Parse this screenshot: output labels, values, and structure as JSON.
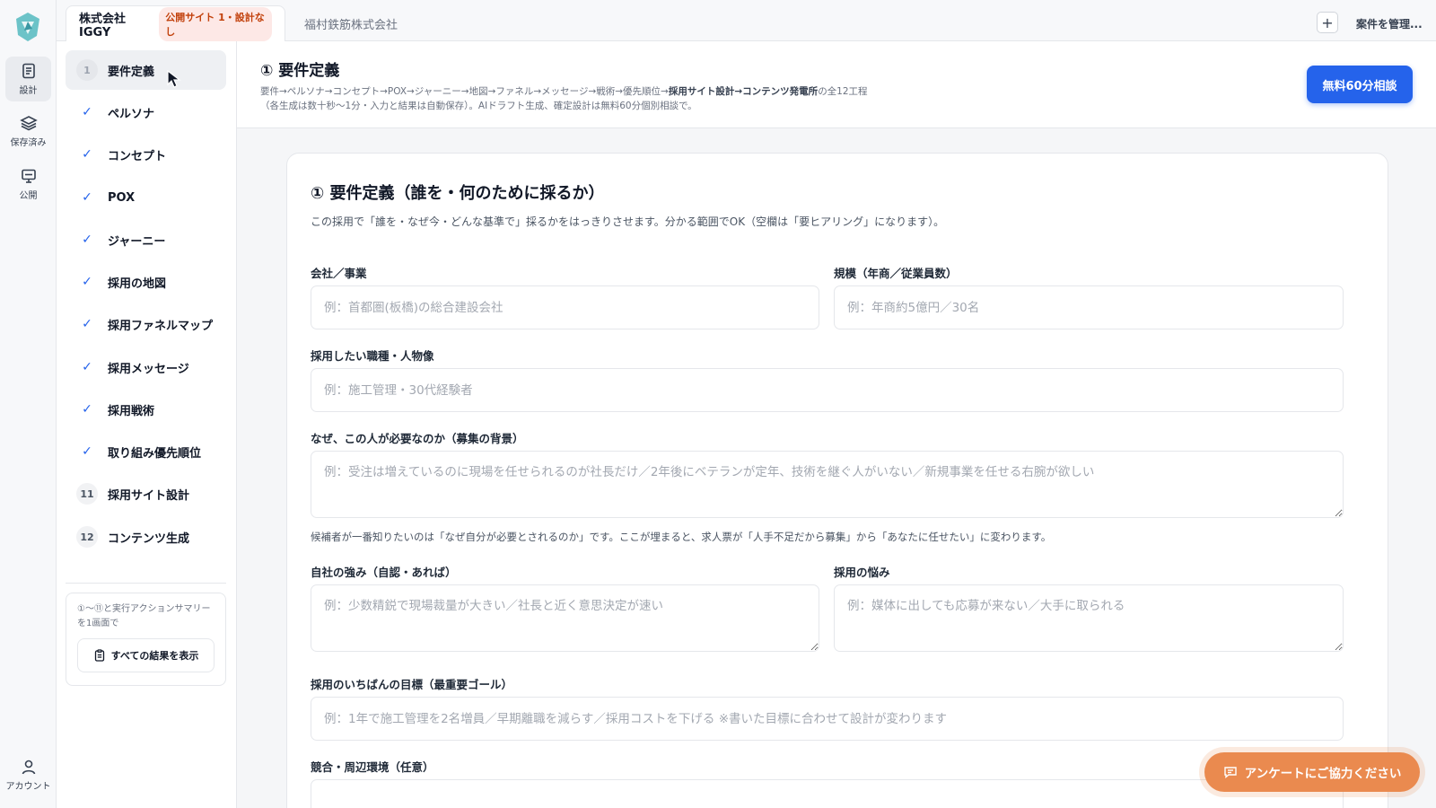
{
  "rail": {
    "items": [
      {
        "label": "設計",
        "icon": "document-icon"
      },
      {
        "label": "保存済み",
        "icon": "layers-icon"
      },
      {
        "label": "公開",
        "icon": "monitor-icon"
      }
    ],
    "account_label": "アカウント"
  },
  "tabs": {
    "active": {
      "label": "株式会社IGGY",
      "badge": "公開サイト 1・設計なし"
    },
    "other": {
      "label": "福村鉄筋株式会社"
    },
    "manage_label": "案件を管理..."
  },
  "steps": {
    "items": [
      {
        "mark": "1",
        "label": "要件定義",
        "state": "current"
      },
      {
        "mark": "✓",
        "label": "ペルソナ",
        "state": "done"
      },
      {
        "mark": "✓",
        "label": "コンセプト",
        "state": "done"
      },
      {
        "mark": "✓",
        "label": "POX",
        "state": "done"
      },
      {
        "mark": "✓",
        "label": "ジャーニー",
        "state": "done"
      },
      {
        "mark": "✓",
        "label": "採用の地図",
        "state": "done"
      },
      {
        "mark": "✓",
        "label": "採用ファネルマップ",
        "state": "done"
      },
      {
        "mark": "✓",
        "label": "採用メッセージ",
        "state": "done"
      },
      {
        "mark": "✓",
        "label": "採用戦術",
        "state": "done"
      },
      {
        "mark": "✓",
        "label": "取り組み優先順位",
        "state": "done"
      },
      {
        "mark": "11",
        "label": "採用サイト設計",
        "state": "todo"
      },
      {
        "mark": "12",
        "label": "コンテンツ生成",
        "state": "todo"
      }
    ],
    "summary_note": "①〜⑪と実行アクションサマリーを1画面で",
    "summary_button": "すべての結果を表示"
  },
  "header": {
    "title": "① 要件定義",
    "flow_plain": "要件→ペルソナ→コンセプト→POX→ジャーニー→地図→ファネル→メッセージ→戦術→優先順位→",
    "flow_bold": "採用サイト設計→コンテンツ発電所",
    "flow_suffix": "の全12工程",
    "flow_line2": "（各生成は数十秒〜1分・入力と結果は自動保存）。AIドラフト生成、確定設計は無料60分個別相談で。",
    "cta_label": "無料60分相談"
  },
  "form": {
    "title": "① 要件定義（誰を・何のために採るか）",
    "description": "この採用で「誰を・なぜ今・どんな基準で」採るかをはっきりさせます。分かる範囲でOK（空欄は「要ヒアリング」になります）。",
    "fields": {
      "company": {
        "label": "会社／事業",
        "placeholder": "例：首都圏(板橋)の総合建設会社",
        "value": ""
      },
      "scale": {
        "label": "規模（年商／従業員数）",
        "placeholder": "例：年商約5億円／30名",
        "value": ""
      },
      "role": {
        "label": "採用したい職種・人物像",
        "placeholder": "例：施工管理・30代経験者",
        "value": ""
      },
      "background": {
        "label": "なぜ、この人が必要なのか（募集の背景）",
        "placeholder": "例：受注は増えているのに現場を任せられるのが社長だけ／2年後にベテランが定年、技術を継ぐ人がいない／新規事業を任せる右腕が欲しい",
        "value": ""
      },
      "strength": {
        "label": "自社の強み（自認・あれば）",
        "placeholder": "例：少数精鋭で現場裁量が大きい／社長と近く意思決定が速い",
        "value": ""
      },
      "worry": {
        "label": "採用の悩み",
        "placeholder": "例：媒体に出しても応募が来ない／大手に取られる",
        "value": ""
      },
      "goal": {
        "label": "採用のいちばんの目標（最重要ゴール）",
        "placeholder": "例：1年で施工管理を2名増員／早期離職を減らす／採用コストを下げる ※書いた目標に合わせて設計が変わります",
        "value": ""
      },
      "competition": {
        "label": "競合・周辺環境（任意）",
        "placeholder": "",
        "value": ""
      }
    },
    "background_hint": "候補者が一番知りたいのは「なぜ自分が必要とされるのか」です。ここが埋まると、求人票が「人手不足だから募集」から「あなたに任せたい」に変わります。"
  },
  "survey_label": "アンケートにご協力ください",
  "colors": {
    "primary": "#2563eb",
    "survey": "#ea8a4f",
    "badge_text": "#c2410c",
    "badge_bg": "#fde8e6"
  }
}
